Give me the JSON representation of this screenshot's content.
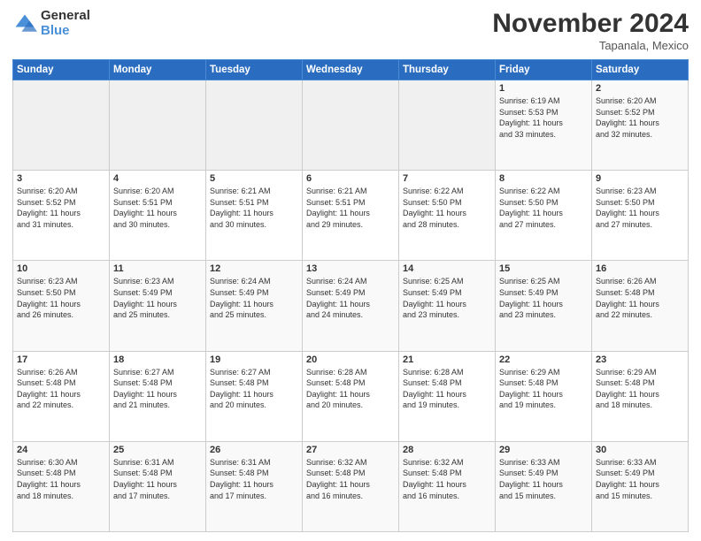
{
  "logo": {
    "general": "General",
    "blue": "Blue"
  },
  "header": {
    "title": "November 2024",
    "location": "Tapanala, Mexico"
  },
  "weekdays": [
    "Sunday",
    "Monday",
    "Tuesday",
    "Wednesday",
    "Thursday",
    "Friday",
    "Saturday"
  ],
  "weeks": [
    [
      {
        "day": "",
        "info": ""
      },
      {
        "day": "",
        "info": ""
      },
      {
        "day": "",
        "info": ""
      },
      {
        "day": "",
        "info": ""
      },
      {
        "day": "",
        "info": ""
      },
      {
        "day": "1",
        "info": "Sunrise: 6:19 AM\nSunset: 5:53 PM\nDaylight: 11 hours\nand 33 minutes."
      },
      {
        "day": "2",
        "info": "Sunrise: 6:20 AM\nSunset: 5:52 PM\nDaylight: 11 hours\nand 32 minutes."
      }
    ],
    [
      {
        "day": "3",
        "info": "Sunrise: 6:20 AM\nSunset: 5:52 PM\nDaylight: 11 hours\nand 31 minutes."
      },
      {
        "day": "4",
        "info": "Sunrise: 6:20 AM\nSunset: 5:51 PM\nDaylight: 11 hours\nand 30 minutes."
      },
      {
        "day": "5",
        "info": "Sunrise: 6:21 AM\nSunset: 5:51 PM\nDaylight: 11 hours\nand 30 minutes."
      },
      {
        "day": "6",
        "info": "Sunrise: 6:21 AM\nSunset: 5:51 PM\nDaylight: 11 hours\nand 29 minutes."
      },
      {
        "day": "7",
        "info": "Sunrise: 6:22 AM\nSunset: 5:50 PM\nDaylight: 11 hours\nand 28 minutes."
      },
      {
        "day": "8",
        "info": "Sunrise: 6:22 AM\nSunset: 5:50 PM\nDaylight: 11 hours\nand 27 minutes."
      },
      {
        "day": "9",
        "info": "Sunrise: 6:23 AM\nSunset: 5:50 PM\nDaylight: 11 hours\nand 27 minutes."
      }
    ],
    [
      {
        "day": "10",
        "info": "Sunrise: 6:23 AM\nSunset: 5:50 PM\nDaylight: 11 hours\nand 26 minutes."
      },
      {
        "day": "11",
        "info": "Sunrise: 6:23 AM\nSunset: 5:49 PM\nDaylight: 11 hours\nand 25 minutes."
      },
      {
        "day": "12",
        "info": "Sunrise: 6:24 AM\nSunset: 5:49 PM\nDaylight: 11 hours\nand 25 minutes."
      },
      {
        "day": "13",
        "info": "Sunrise: 6:24 AM\nSunset: 5:49 PM\nDaylight: 11 hours\nand 24 minutes."
      },
      {
        "day": "14",
        "info": "Sunrise: 6:25 AM\nSunset: 5:49 PM\nDaylight: 11 hours\nand 23 minutes."
      },
      {
        "day": "15",
        "info": "Sunrise: 6:25 AM\nSunset: 5:49 PM\nDaylight: 11 hours\nand 23 minutes."
      },
      {
        "day": "16",
        "info": "Sunrise: 6:26 AM\nSunset: 5:48 PM\nDaylight: 11 hours\nand 22 minutes."
      }
    ],
    [
      {
        "day": "17",
        "info": "Sunrise: 6:26 AM\nSunset: 5:48 PM\nDaylight: 11 hours\nand 22 minutes."
      },
      {
        "day": "18",
        "info": "Sunrise: 6:27 AM\nSunset: 5:48 PM\nDaylight: 11 hours\nand 21 minutes."
      },
      {
        "day": "19",
        "info": "Sunrise: 6:27 AM\nSunset: 5:48 PM\nDaylight: 11 hours\nand 20 minutes."
      },
      {
        "day": "20",
        "info": "Sunrise: 6:28 AM\nSunset: 5:48 PM\nDaylight: 11 hours\nand 20 minutes."
      },
      {
        "day": "21",
        "info": "Sunrise: 6:28 AM\nSunset: 5:48 PM\nDaylight: 11 hours\nand 19 minutes."
      },
      {
        "day": "22",
        "info": "Sunrise: 6:29 AM\nSunset: 5:48 PM\nDaylight: 11 hours\nand 19 minutes."
      },
      {
        "day": "23",
        "info": "Sunrise: 6:29 AM\nSunset: 5:48 PM\nDaylight: 11 hours\nand 18 minutes."
      }
    ],
    [
      {
        "day": "24",
        "info": "Sunrise: 6:30 AM\nSunset: 5:48 PM\nDaylight: 11 hours\nand 18 minutes."
      },
      {
        "day": "25",
        "info": "Sunrise: 6:31 AM\nSunset: 5:48 PM\nDaylight: 11 hours\nand 17 minutes."
      },
      {
        "day": "26",
        "info": "Sunrise: 6:31 AM\nSunset: 5:48 PM\nDaylight: 11 hours\nand 17 minutes."
      },
      {
        "day": "27",
        "info": "Sunrise: 6:32 AM\nSunset: 5:48 PM\nDaylight: 11 hours\nand 16 minutes."
      },
      {
        "day": "28",
        "info": "Sunrise: 6:32 AM\nSunset: 5:48 PM\nDaylight: 11 hours\nand 16 minutes."
      },
      {
        "day": "29",
        "info": "Sunrise: 6:33 AM\nSunset: 5:49 PM\nDaylight: 11 hours\nand 15 minutes."
      },
      {
        "day": "30",
        "info": "Sunrise: 6:33 AM\nSunset: 5:49 PM\nDaylight: 11 hours\nand 15 minutes."
      }
    ]
  ]
}
